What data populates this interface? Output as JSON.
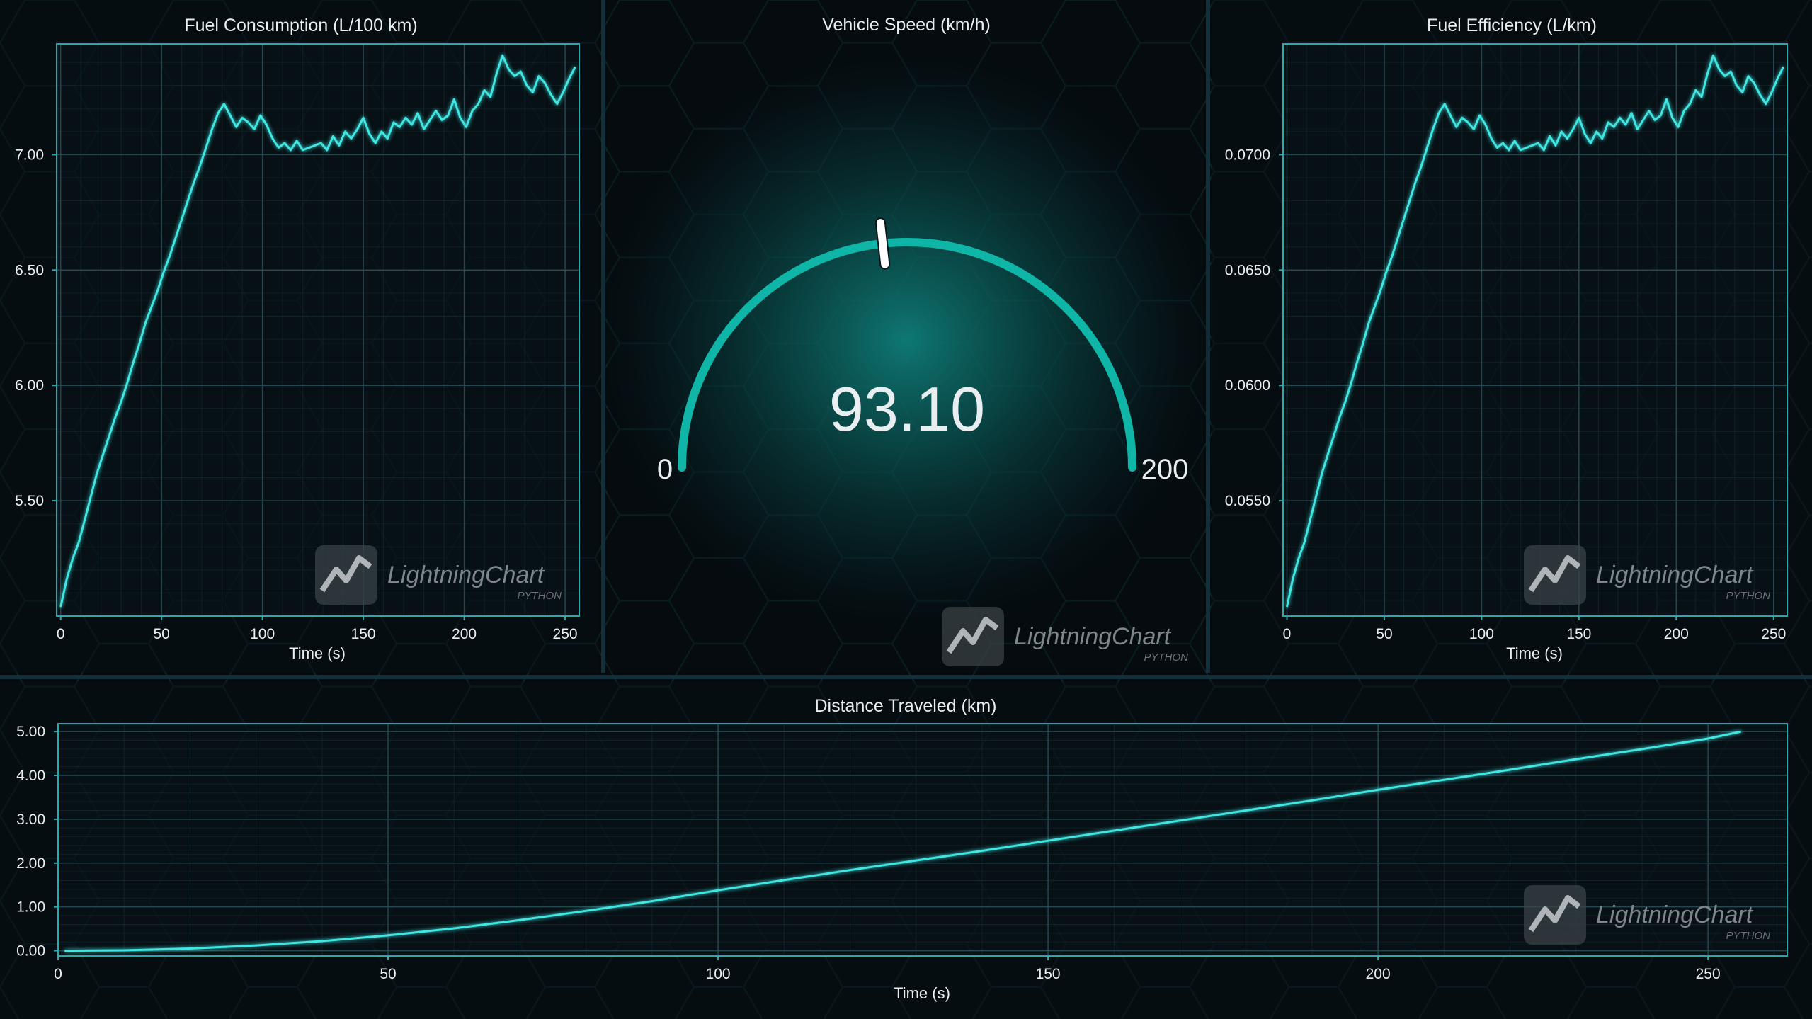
{
  "theme": {
    "background": "#05090d",
    "panel": "#0a1419",
    "line": "#3fe6e2",
    "axis": "#26a9b0",
    "grid": "#1b3339",
    "gauge": "#0fb5a6",
    "gauge_glow": "#0c6e6b",
    "text": "#e9eef0"
  },
  "watermark": {
    "brand": "LightningChart",
    "sub": "PYTHON"
  },
  "chart_data": [
    {
      "id": "fuel_consumption",
      "type": "line",
      "title": "Fuel Consumption (L/100 km)",
      "xlabel": "Time (s)",
      "ylabel": "",
      "xlim": [
        -2,
        257
      ],
      "ylim": [
        5.0,
        7.48
      ],
      "xticks": [
        0,
        50,
        100,
        150,
        200,
        250
      ],
      "yticks": [
        5.5,
        6.0,
        6.5,
        7.0
      ],
      "ytick_labels": [
        "5.50",
        "6.00",
        "6.50",
        "7.00"
      ],
      "grid": true,
      "x": [
        0,
        3,
        6,
        9,
        12,
        15,
        18,
        21,
        24,
        27,
        30,
        33,
        36,
        39,
        42,
        45,
        48,
        51,
        54,
        57,
        60,
        63,
        66,
        69,
        72,
        75,
        78,
        81,
        84,
        87,
        90,
        93,
        96,
        99,
        102,
        105,
        108,
        111,
        114,
        117,
        120,
        123,
        126,
        129,
        132,
        135,
        138,
        141,
        144,
        147,
        150,
        153,
        156,
        159,
        162,
        165,
        168,
        171,
        174,
        177,
        180,
        183,
        186,
        189,
        192,
        195,
        198,
        201,
        204,
        207,
        210,
        213,
        216,
        219,
        222,
        225,
        228,
        231,
        234,
        237,
        240,
        243,
        246,
        249,
        252,
        255
      ],
      "y": [
        5.04,
        5.16,
        5.25,
        5.32,
        5.42,
        5.52,
        5.62,
        5.7,
        5.78,
        5.86,
        5.93,
        6.01,
        6.1,
        6.18,
        6.27,
        6.34,
        6.41,
        6.49,
        6.56,
        6.64,
        6.72,
        6.8,
        6.88,
        6.95,
        7.03,
        7.11,
        7.18,
        7.22,
        7.17,
        7.12,
        7.16,
        7.14,
        7.11,
        7.17,
        7.13,
        7.07,
        7.03,
        7.05,
        7.02,
        7.06,
        7.02,
        7.03,
        7.04,
        7.05,
        7.02,
        7.08,
        7.04,
        7.1,
        7.07,
        7.11,
        7.16,
        7.09,
        7.05,
        7.1,
        7.07,
        7.14,
        7.12,
        7.16,
        7.13,
        7.18,
        7.11,
        7.15,
        7.19,
        7.15,
        7.17,
        7.24,
        7.16,
        7.12,
        7.19,
        7.22,
        7.28,
        7.25,
        7.35,
        7.43,
        7.37,
        7.34,
        7.36,
        7.3,
        7.27,
        7.34,
        7.31,
        7.26,
        7.22,
        7.27,
        7.33,
        7.38
      ]
    },
    {
      "id": "vehicle_speed",
      "type": "gauge",
      "title": "Vehicle Speed (km/h)",
      "min": 0,
      "max": 200,
      "min_label": "0",
      "max_label": "200",
      "value": 93.1,
      "value_label": "93.10"
    },
    {
      "id": "fuel_efficiency",
      "type": "line",
      "title": "Fuel Efficiency (L/km)",
      "xlabel": "Time (s)",
      "ylabel": "",
      "xlim": [
        -2,
        257
      ],
      "ylim": [
        0.05,
        0.0748
      ],
      "xticks": [
        0,
        50,
        100,
        150,
        200,
        250
      ],
      "yticks": [
        0.055,
        0.06,
        0.065,
        0.07
      ],
      "ytick_labels": [
        "0.0550",
        "0.0600",
        "0.0650",
        "0.0700"
      ],
      "grid": true,
      "x": [
        0,
        3,
        6,
        9,
        12,
        15,
        18,
        21,
        24,
        27,
        30,
        33,
        36,
        39,
        42,
        45,
        48,
        51,
        54,
        57,
        60,
        63,
        66,
        69,
        72,
        75,
        78,
        81,
        84,
        87,
        90,
        93,
        96,
        99,
        102,
        105,
        108,
        111,
        114,
        117,
        120,
        123,
        126,
        129,
        132,
        135,
        138,
        141,
        144,
        147,
        150,
        153,
        156,
        159,
        162,
        165,
        168,
        171,
        174,
        177,
        180,
        183,
        186,
        189,
        192,
        195,
        198,
        201,
        204,
        207,
        210,
        213,
        216,
        219,
        222,
        225,
        228,
        231,
        234,
        237,
        240,
        243,
        246,
        249,
        252,
        255
      ],
      "y": [
        0.0504,
        0.0516,
        0.0525,
        0.0532,
        0.0542,
        0.0552,
        0.0562,
        0.057,
        0.0578,
        0.0586,
        0.0593,
        0.0601,
        0.061,
        0.0618,
        0.0627,
        0.0634,
        0.0641,
        0.0649,
        0.0656,
        0.0664,
        0.0672,
        0.068,
        0.0688,
        0.0695,
        0.0703,
        0.0711,
        0.0718,
        0.0722,
        0.0717,
        0.0712,
        0.0716,
        0.0714,
        0.0711,
        0.0717,
        0.0713,
        0.0707,
        0.0703,
        0.0705,
        0.0702,
        0.0706,
        0.0702,
        0.0703,
        0.0704,
        0.0705,
        0.0702,
        0.0708,
        0.0704,
        0.071,
        0.0707,
        0.0711,
        0.0716,
        0.0709,
        0.0705,
        0.071,
        0.0707,
        0.0714,
        0.0712,
        0.0716,
        0.0713,
        0.0718,
        0.0711,
        0.0715,
        0.0719,
        0.0715,
        0.0717,
        0.0724,
        0.0716,
        0.0712,
        0.0719,
        0.0722,
        0.0728,
        0.0725,
        0.0735,
        0.0743,
        0.0737,
        0.0734,
        0.0736,
        0.073,
        0.0727,
        0.0734,
        0.0731,
        0.0726,
        0.0722,
        0.0727,
        0.0733,
        0.0738
      ]
    },
    {
      "id": "distance_traveled",
      "type": "line",
      "title": "Distance Traveled (km)",
      "xlabel": "Time (s)",
      "ylabel": "",
      "xlim": [
        0,
        262
      ],
      "ylim": [
        -0.12,
        5.18
      ],
      "xticks": [
        0,
        50,
        100,
        150,
        200,
        250
      ],
      "yticks": [
        0,
        1,
        2,
        3,
        4,
        5
      ],
      "ytick_labels": [
        "0.00",
        "1.00",
        "2.00",
        "3.00",
        "4.00",
        "5.00"
      ],
      "grid": true,
      "x": [
        1,
        10,
        20,
        30,
        40,
        50,
        60,
        70,
        80,
        90,
        100,
        110,
        120,
        130,
        140,
        150,
        160,
        170,
        180,
        190,
        200,
        210,
        220,
        230,
        240,
        250,
        255
      ],
      "y": [
        0.0,
        0.01,
        0.05,
        0.12,
        0.22,
        0.35,
        0.51,
        0.7,
        0.91,
        1.13,
        1.38,
        1.61,
        1.84,
        2.06,
        2.28,
        2.51,
        2.74,
        2.97,
        3.2,
        3.43,
        3.67,
        3.9,
        4.13,
        4.37,
        4.6,
        4.84,
        5.0
      ]
    }
  ]
}
